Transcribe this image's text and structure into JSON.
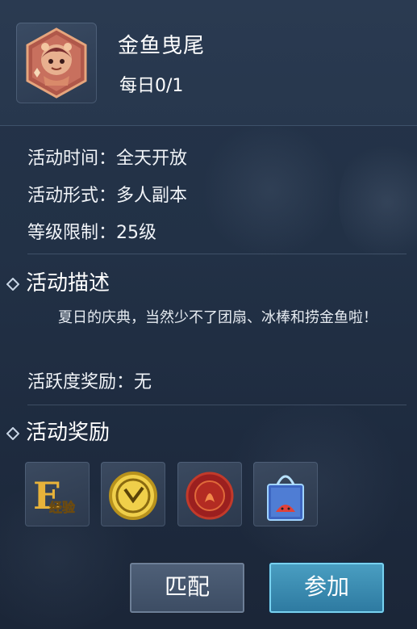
{
  "activity": {
    "title": "金鱼曳尾",
    "daily": "每日0/1"
  },
  "info": {
    "time": "活动时间：全天开放",
    "form": "活动形式：多人副本",
    "level": "等级限制：25级"
  },
  "description": {
    "heading": "活动描述",
    "text": "夏日的庆典，当然少不了团扇、冰棒和捞金鱼啦！"
  },
  "activity_reward": "活跃度奖励：无",
  "rewards": {
    "heading": "活动奖励",
    "items": [
      {
        "icon": "exp-icon",
        "label": "经验"
      },
      {
        "icon": "coin-icon"
      },
      {
        "icon": "wax-seal-icon"
      },
      {
        "icon": "gift-bag-icon"
      }
    ]
  },
  "buttons": {
    "match": "匹配",
    "join": "参加"
  },
  "colors": {
    "accent": "#2d79a0",
    "panel": "#223146"
  }
}
